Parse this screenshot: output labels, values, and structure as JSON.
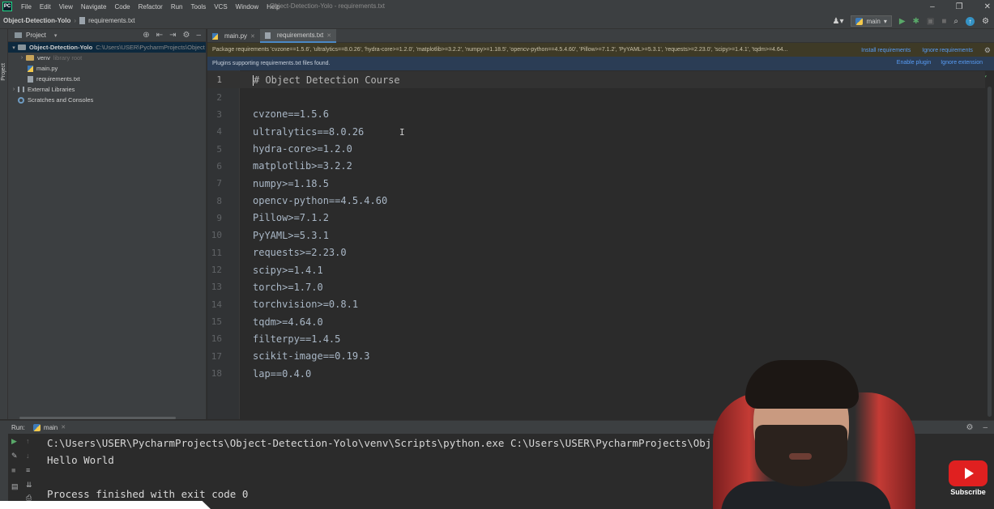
{
  "app": {
    "logo": "PC",
    "window_title": "Object-Detection-Yolo - requirements.txt",
    "menu": [
      "File",
      "Edit",
      "View",
      "Navigate",
      "Code",
      "Refactor",
      "Run",
      "Tools",
      "VCS",
      "Window",
      "Help"
    ]
  },
  "navbar": {
    "project": "Object-Detection-Yolo",
    "file": "requirements.txt",
    "run_config": "main"
  },
  "project_panel": {
    "title": "Project",
    "stripe_label": "Project",
    "tree": [
      {
        "label": "Object-Detection-Yolo",
        "path": "C:\\Users\\USER\\PycharmProjects\\Object"
      },
      {
        "label": "venv",
        "extra": "library root"
      },
      {
        "label": "main.py"
      },
      {
        "label": "requirements.txt"
      },
      {
        "label": "External Libraries"
      },
      {
        "label": "Scratches and Consoles"
      }
    ]
  },
  "editor": {
    "tabs": [
      {
        "label": "main.py"
      },
      {
        "label": "requirements.txt"
      }
    ],
    "banner_requirements": {
      "text": "Package requirements 'cvzone==1.5.6', 'ultralytics==8.0.26', 'hydra-core>=1.2.0', 'matplotlib>=3.2.2', 'numpy>=1.18.5', 'opencv-python==4.5.4.60', 'Pillow>=7.1.2', 'PyYAML>=5.3.1', 'requests>=2.23.0', 'scipy>=1.4.1', 'tqdm>=4.64...",
      "install": "Install requirements",
      "ignore": "Ignore requirements"
    },
    "banner_plugins": {
      "text": "Plugins supporting requirements.txt files found.",
      "enable": "Enable plugin",
      "ignore": "Ignore extension"
    },
    "lines": [
      {
        "num": "1",
        "text": "# Object Detection Course"
      },
      {
        "num": "2",
        "text": ""
      },
      {
        "num": "3",
        "text": "cvzone==1.5.6"
      },
      {
        "num": "4",
        "text": "ultralytics==8.0.26"
      },
      {
        "num": "5",
        "text": "hydra-core>=1.2.0"
      },
      {
        "num": "6",
        "text": "matplotlib>=3.2.2"
      },
      {
        "num": "7",
        "text": "numpy>=1.18.5"
      },
      {
        "num": "8",
        "text": "opencv-python==4.5.4.60"
      },
      {
        "num": "9",
        "text": "Pillow>=7.1.2"
      },
      {
        "num": "10",
        "text": "PyYAML>=5.3.1"
      },
      {
        "num": "11",
        "text": "requests>=2.23.0"
      },
      {
        "num": "12",
        "text": "scipy>=1.4.1"
      },
      {
        "num": "13",
        "text": "torch>=1.7.0"
      },
      {
        "num": "14",
        "text": "torchvision>=0.8.1"
      },
      {
        "num": "15",
        "text": "tqdm>=4.64.0"
      },
      {
        "num": "16",
        "text": "filterpy==1.4.5"
      },
      {
        "num": "17",
        "text": "scikit-image==0.19.3"
      },
      {
        "num": "18",
        "text": "lap==0.4.0"
      }
    ]
  },
  "run_panel": {
    "label": "Run:",
    "tab": "main",
    "console": [
      "C:\\Users\\USER\\PycharmProjects\\Object-Detection-Yolo\\venv\\Scripts\\python.exe C:\\Users\\USER\\PycharmProjects\\Obj",
      "Hello World",
      "",
      "Process finished with exit code 0"
    ]
  },
  "overlay": {
    "youtube_label": "Subscribe"
  },
  "colors": {
    "accent": "#4a88c7",
    "link": "#589df6",
    "editor_bg": "#2b2b2b",
    "panel_bg": "#3c3f41"
  }
}
